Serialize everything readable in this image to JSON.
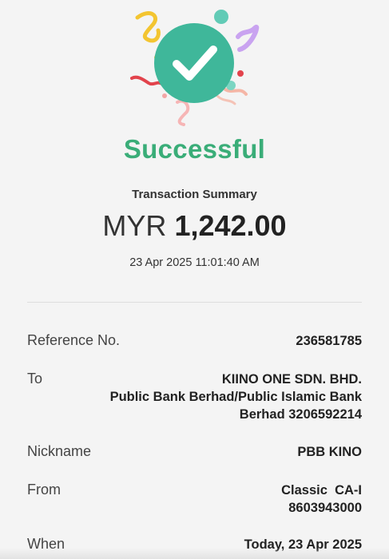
{
  "status": {
    "title": "Successful"
  },
  "summary": {
    "label": "Transaction Summary",
    "currency": "MYR",
    "amount": "1,242.00",
    "datetime": "23 Apr 2025 11:01:40 AM"
  },
  "details": {
    "reference": {
      "label": "Reference No.",
      "value": "236581785"
    },
    "to": {
      "label": "To",
      "line1": "KIINO ONE SDN. BHD.",
      "line2": "Public Bank Berhad/Public Islamic Bank",
      "line3": "Berhad 3206592214"
    },
    "nickname": {
      "label": "Nickname",
      "value": "PBB KINO"
    },
    "from": {
      "label": "From",
      "line1": "Classic  CA-I",
      "line2": "8603943000"
    },
    "when": {
      "label": "When",
      "value": "Today, 23 Apr 2025"
    }
  },
  "colors": {
    "success": "#3aad78",
    "badge": "#3fb79a"
  },
  "icons": {
    "badge": "check-circle-icon"
  }
}
